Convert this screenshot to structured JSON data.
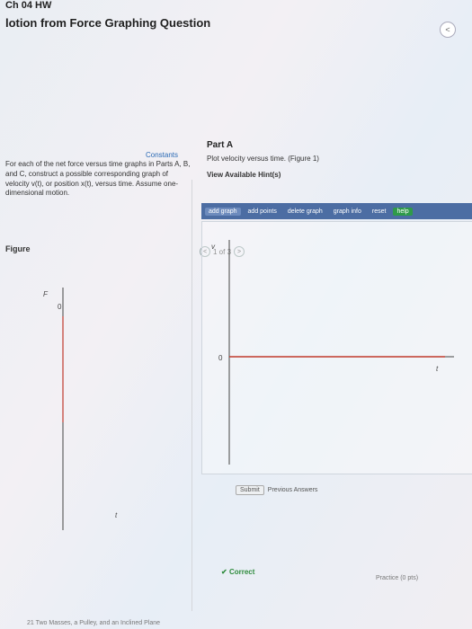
{
  "header": {
    "course": "Ch 04 HW",
    "title": "lotion from Force Graphing Question",
    "prev_symbol": "<"
  },
  "left": {
    "constants_link": "Constants",
    "problem_text": "For each of the net force versus time graphs in Parts A, B, and C, construct a possible corresponding graph of velocity v(t), or position x(t), versus time. Assume one-dimensional motion.",
    "figure_label": "Figure",
    "pager": {
      "prev": "<",
      "text": "1 of 3",
      "next": ">"
    },
    "figure_axes": {
      "y_label": "F",
      "x_label": "t",
      "origin_label": "0"
    }
  },
  "right": {
    "part_title": "Part A",
    "instruction": "Plot velocity versus time. (Figure 1)",
    "hint_link": "View Available Hint(s)",
    "toolbar": {
      "add_graph": "add graph",
      "add_points": "add points",
      "delete_graph": "delete graph",
      "graph_info": "graph info",
      "reset": "reset",
      "help": "help"
    },
    "graph_axes": {
      "y_label": "v",
      "x_label": "t",
      "origin_label": "0"
    },
    "submit": "Submit",
    "previous_answers": "Previous Answers",
    "correct": "Correct",
    "practice": "Practice (0 pts)"
  },
  "footer": {
    "next_item": "21 Two Masses, a Pulley, and an Inclined Plane"
  },
  "colors": {
    "toolbar": "#4c6da3",
    "force_line": "#c0392b",
    "correct": "#2e8b3c",
    "link": "#2a6ab5"
  }
}
